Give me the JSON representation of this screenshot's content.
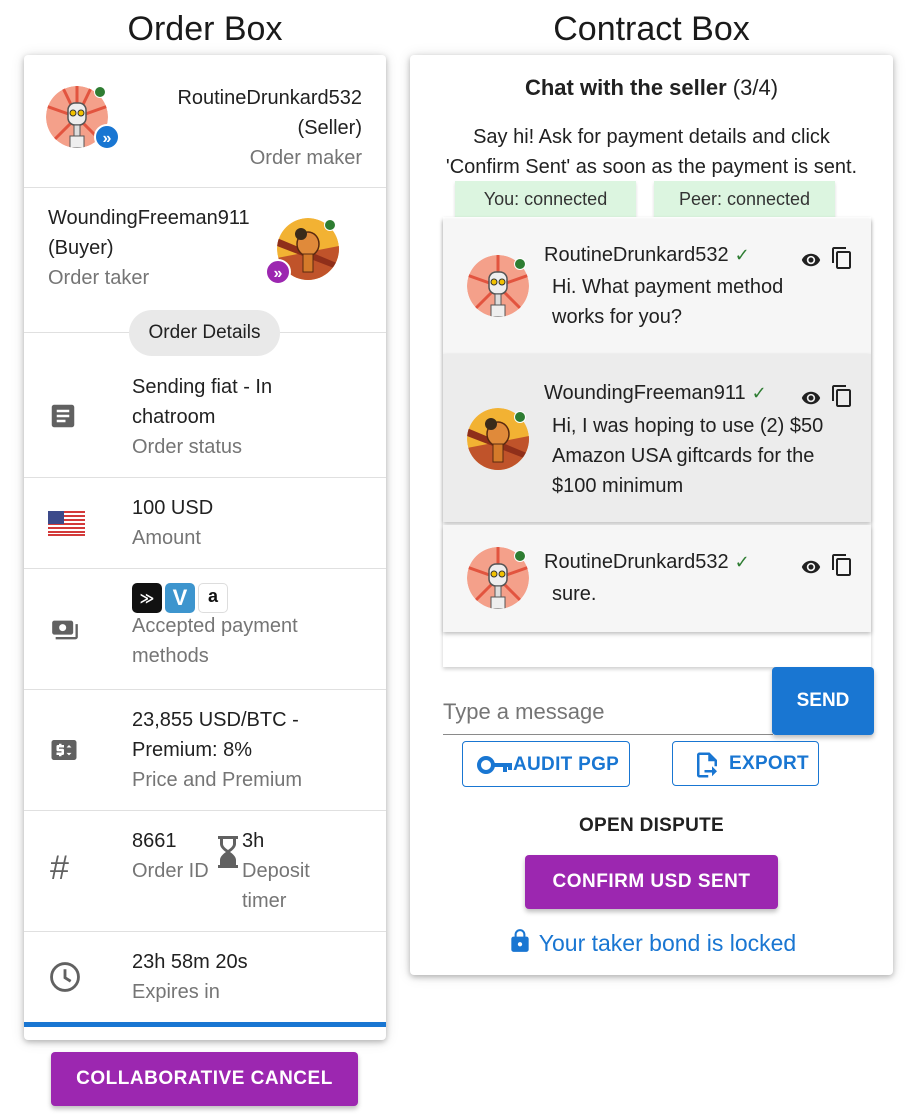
{
  "order_box": {
    "title": "Order Box",
    "maker": {
      "name": "RoutineDrunkard532",
      "role": "(Seller)",
      "label": "Order maker"
    },
    "taker": {
      "name": "WoundingFreeman911",
      "role": "(Buyer)",
      "label": "Order taker"
    },
    "details_chip": "Order Details",
    "status": {
      "value_line1": "Sending fiat - In",
      "value_line2": "chatroom",
      "label": "Order status"
    },
    "amount": {
      "value": "100 USD",
      "label": "Amount"
    },
    "payment": {
      "label_line1": "Accepted payment",
      "label_line2": "methods",
      "icons": [
        "cash-app-icon",
        "venmo-icon",
        "amazon-usa-icon"
      ]
    },
    "price": {
      "value_line1": "23,855 USD/BTC -",
      "value_line2": "Premium: 8%",
      "label": "Price and Premium"
    },
    "order_id": {
      "value": "8661",
      "label": "Order ID"
    },
    "deposit": {
      "value": "3h",
      "label_line1": "Deposit",
      "label_line2": "timer"
    },
    "expires": {
      "value": "23h 58m 20s",
      "label": "Expires in"
    },
    "cancel_button": "COLLABORATIVE CANCEL"
  },
  "contract_box": {
    "title": "Contract Box",
    "chat_title": "Chat with the seller",
    "chat_step": "(3/4)",
    "instructions_line1": "Say hi! Ask for payment details and click",
    "instructions_line2": "'Confirm Sent' as soon as the payment is sent.",
    "you_status": "You: connected",
    "peer_status": "Peer: connected",
    "messages": [
      {
        "author": "RoutineDrunkard532",
        "line1": "Hi. What payment method",
        "line2": "works for you?",
        "line3": ""
      },
      {
        "author": "WoundingFreeman911",
        "line1": "Hi, I was hoping to use (2) $50",
        "line2": "Amazon USA giftcards for the",
        "line3": "$100 minimum"
      },
      {
        "author": "RoutineDrunkard532",
        "line1": "sure.",
        "line2": "",
        "line3": ""
      }
    ],
    "message_placeholder": "Type a message",
    "send_button": "SEND",
    "audit_button": "AUDIT PGP",
    "export_button": "EXPORT",
    "dispute_button": "OPEN DISPUTE",
    "confirm_button": "CONFIRM USD SENT",
    "bond_status": "Your taker bond is locked"
  },
  "colors": {
    "accent_blue": "#1976d2",
    "accent_purple": "#9c27b0",
    "online_green": "#2e7d32",
    "connected_bg": "#dcf5e0"
  }
}
